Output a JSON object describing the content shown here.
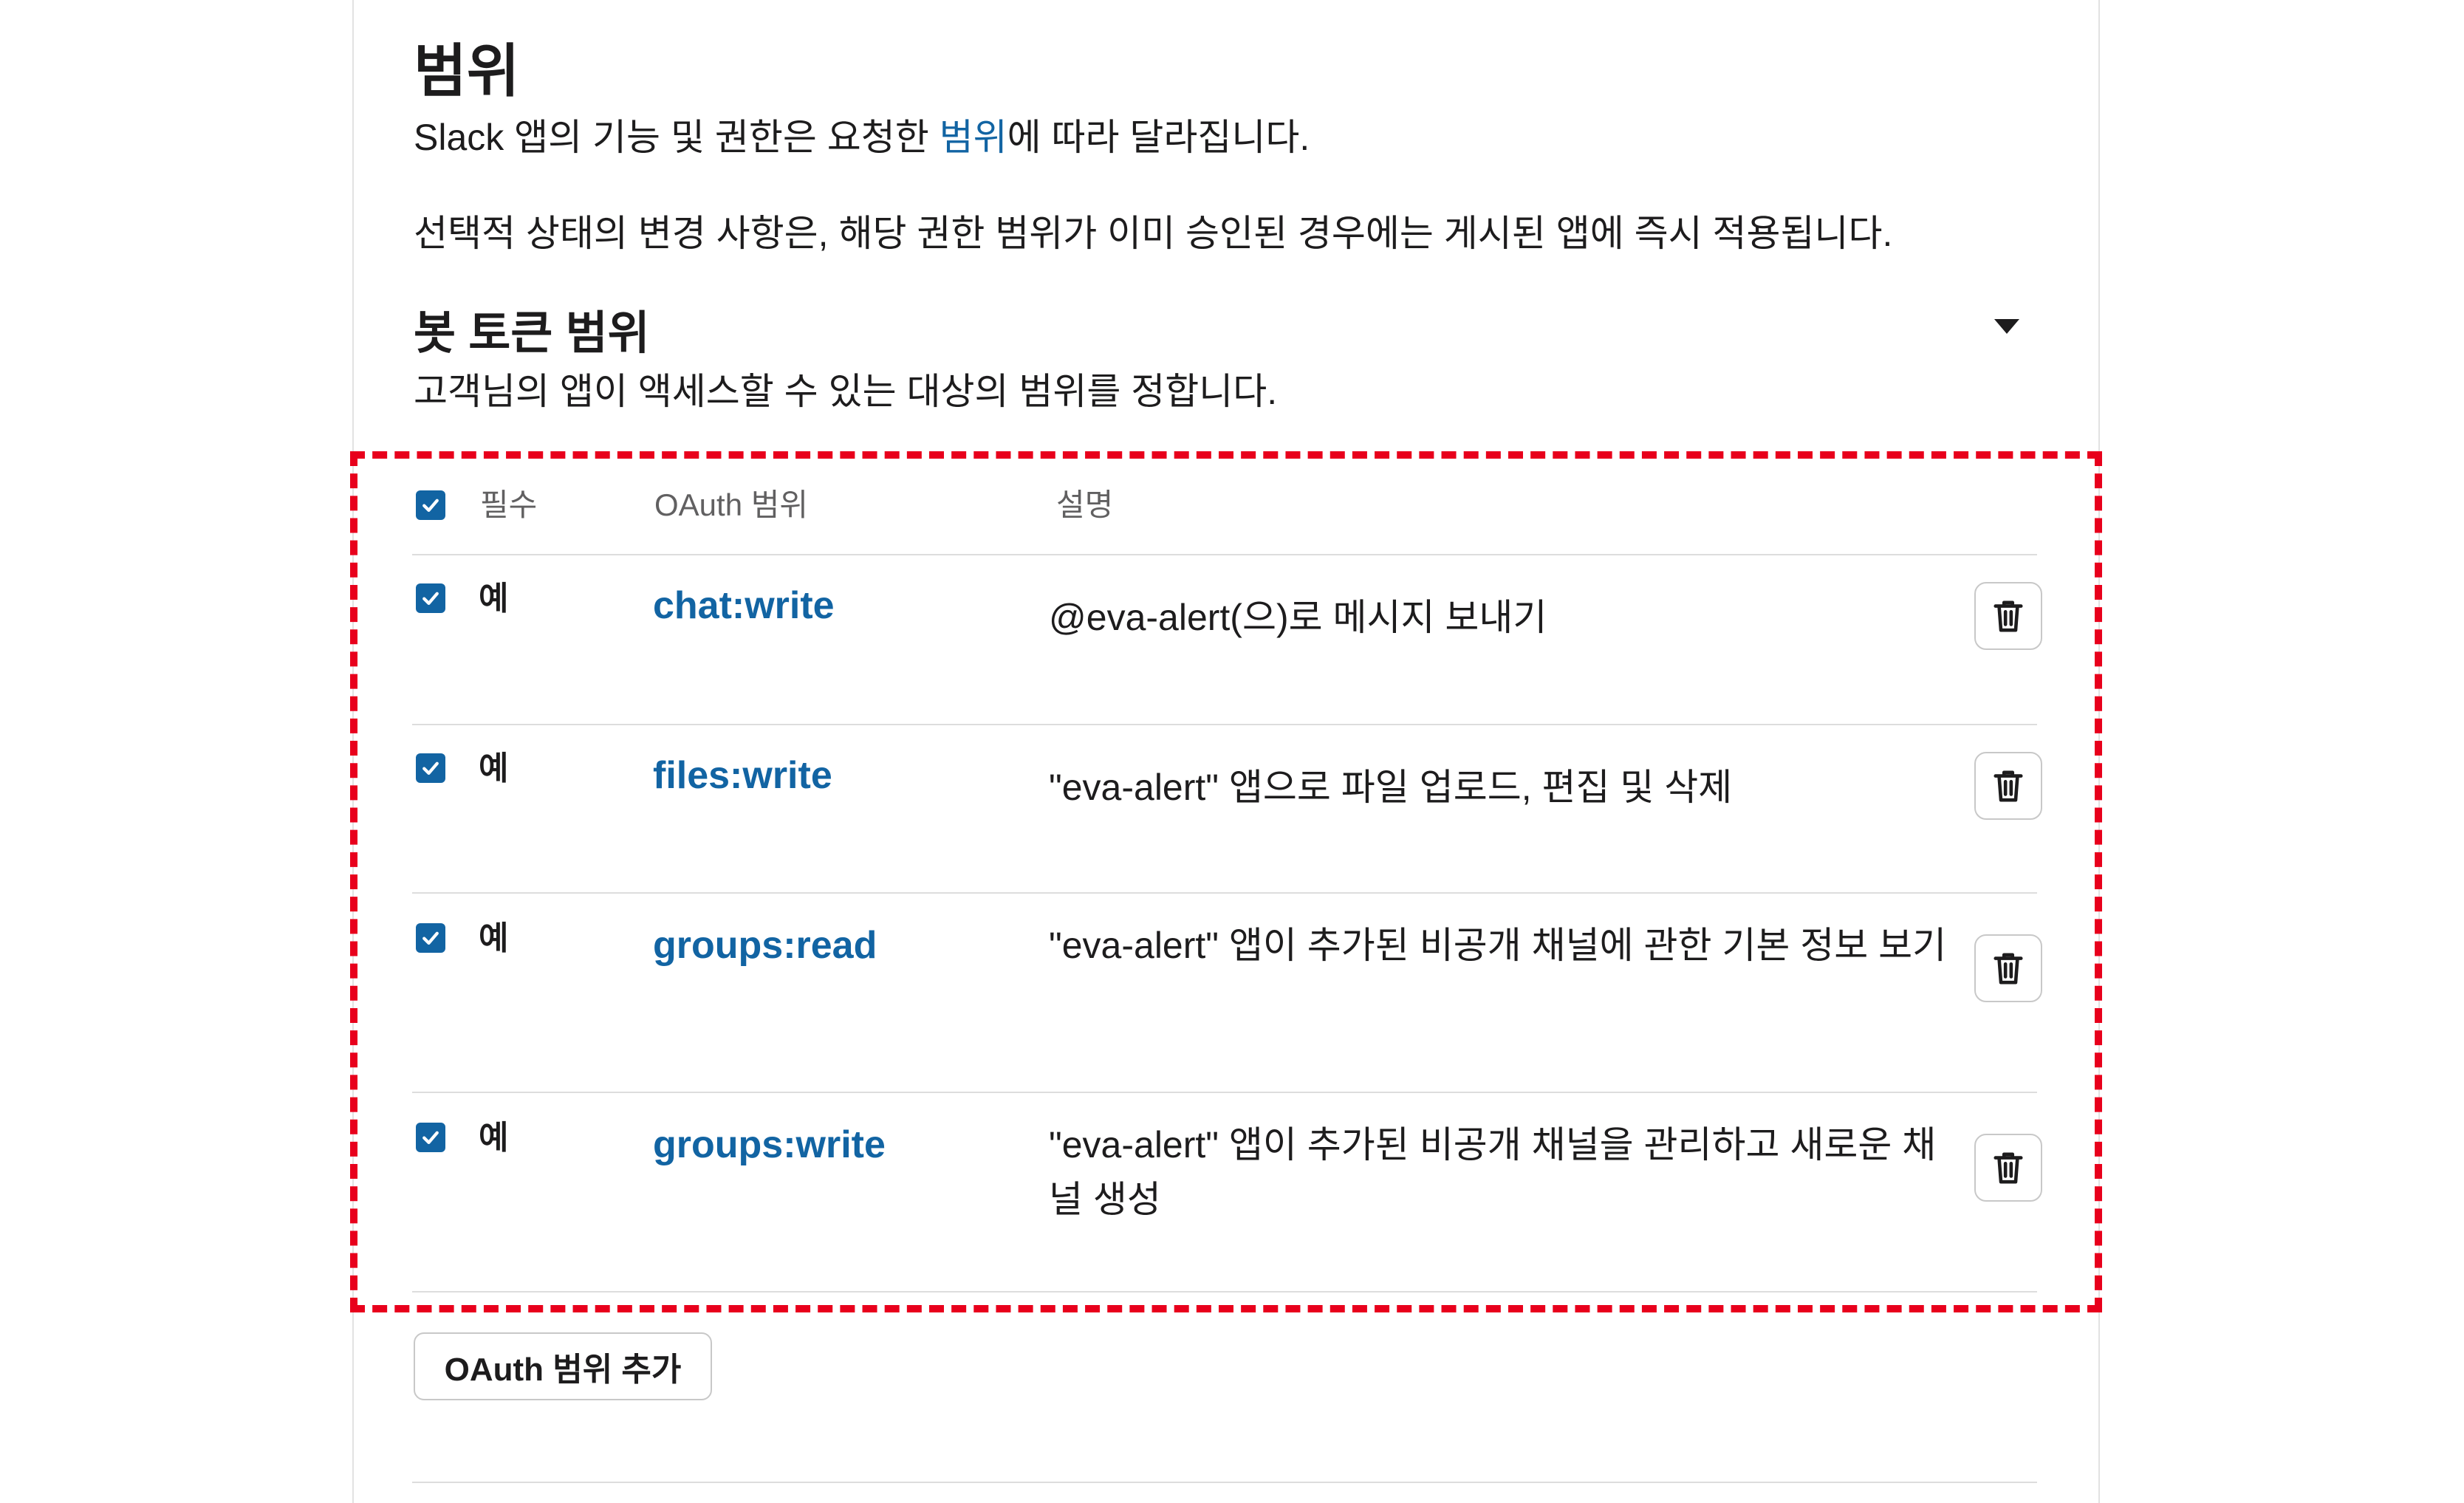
{
  "section": {
    "title": "범위",
    "intro_prefix": "Slack 앱의 기능 및 권한은 요청한 ",
    "intro_link": "범위",
    "intro_suffix": "에 따라 달라집니다.",
    "note": "선택적 상태의 변경 사항은, 해당 권한 범위가 이미 승인된 경우에는 게시된 앱에 즉시 적용됩니다."
  },
  "bot_scopes": {
    "title": "봇 토큰 범위",
    "description": "고객님의 앱이 액세스할 수 있는 대상의 범위를 정합니다.",
    "collapse_icon": "caret-down-icon",
    "columns": {
      "required": "필수",
      "scope": "OAuth 범위",
      "description": "설명"
    },
    "rows": [
      {
        "required_label": "예",
        "scope": "chat:write",
        "description": "@eva-alert(으)로 메시지 보내기"
      },
      {
        "required_label": "예",
        "scope": "files:write",
        "description": "\"eva-alert\" 앱으로 파일 업로드, 편집 및 삭제"
      },
      {
        "required_label": "예",
        "scope": "groups:read",
        "description": "\"eva-alert\" 앱이 추가된 비공개 채널에 관한 기본 정보 보기"
      },
      {
        "required_label": "예",
        "scope": "groups:write",
        "description": "\"eva-alert\" 앱이 추가된 비공개 채널을 관리하고 새로운 채널 생성"
      }
    ],
    "add_button": "OAuth 범위 추가"
  },
  "colors": {
    "accent": "#1264a3",
    "highlight": "#e8001c"
  }
}
